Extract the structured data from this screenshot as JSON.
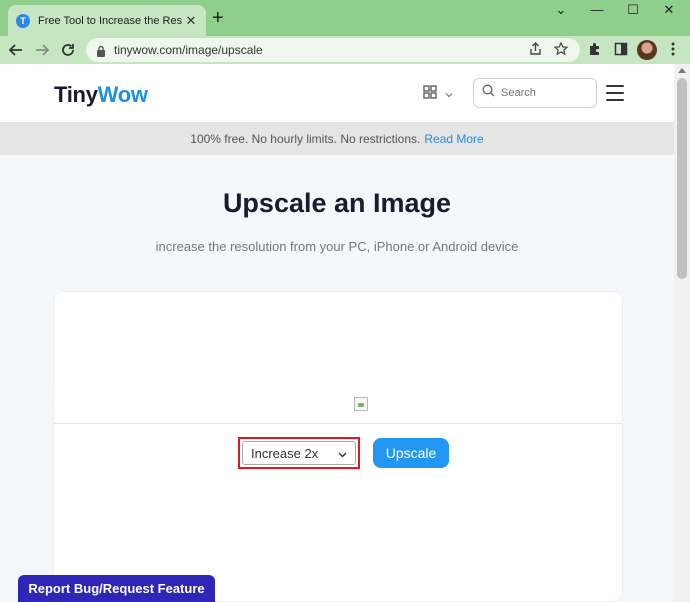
{
  "browser": {
    "tab_title": "Free Tool to Increase the Resolution",
    "favicon_letter": "T",
    "tab_close": "✕",
    "new_tab": "+",
    "url": "tinywow.com/image/upscale",
    "window_controls": {
      "minimize": "—",
      "maximize": "☐",
      "close": "✕"
    },
    "chevron": "⌄"
  },
  "header": {
    "logo_part1": "Tiny",
    "logo_part2": "Wow",
    "search_placeholder": "Search"
  },
  "banner": {
    "text": "100% free. No hourly limits. No restrictions.",
    "link": "Read More"
  },
  "main": {
    "title": "Upscale an Image",
    "subtitle": "increase the resolution from your PC, iPhone or Android device",
    "select_value": "Increase 2x",
    "upscale_button": "Upscale"
  },
  "footer": {
    "report_button": "Report Bug/Request Feature"
  },
  "colors": {
    "accent": "#1f8fe0",
    "button_blue": "#2196f3",
    "highlight_red": "#e0191f",
    "report_purple": "#2f26b8",
    "chrome_green": "#8fcf8b"
  }
}
